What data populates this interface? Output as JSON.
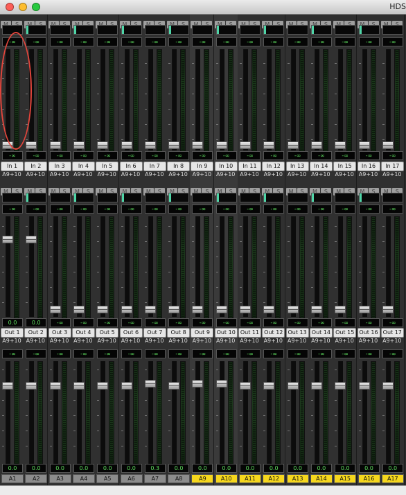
{
  "window": {
    "title": "HDS"
  },
  "strips": [
    {
      "in": "In 1",
      "out": "Out 1",
      "route": "A9+10",
      "a": "A1",
      "yellow": false,
      "gain": "0.0",
      "fader": "0.0",
      "h": 0.05
    },
    {
      "in": "In 2",
      "out": "Out 2",
      "route": "A9+10",
      "a": "A2",
      "yellow": false,
      "gain": "0.0",
      "fader": "0.0",
      "h": 0.05
    },
    {
      "in": "In 3",
      "out": "Out 3",
      "route": "A9+10",
      "a": "A3",
      "yellow": false,
      "gain": "-∞",
      "fader": "0.0",
      "h": 0.05
    },
    {
      "in": "In 4",
      "out": "Out 4",
      "route": "A9+10",
      "a": "A4",
      "yellow": false,
      "gain": "-∞",
      "fader": "0.0",
      "h": 0.05
    },
    {
      "in": "In 5",
      "out": "Out 5",
      "route": "A9+10",
      "a": "A5",
      "yellow": false,
      "gain": "-∞",
      "fader": "0.0",
      "h": 0.05
    },
    {
      "in": "In 6",
      "out": "Out 6",
      "route": "A9+10",
      "a": "A6",
      "yellow": false,
      "gain": "-∞",
      "fader": "0.0",
      "h": 0.05
    },
    {
      "in": "In 7",
      "out": "Out 7",
      "route": "A9+10",
      "a": "A7",
      "yellow": false,
      "gain": "-∞",
      "fader": "0.3",
      "h": 0.05
    },
    {
      "in": "In 8",
      "out": "Out 8",
      "route": "A9+10",
      "a": "A8",
      "yellow": false,
      "gain": "-∞",
      "fader": "0.0",
      "h": 0.05
    },
    {
      "in": "In 9",
      "out": "Out 9",
      "route": "A9+10",
      "a": "A9",
      "yellow": true,
      "gain": "-∞",
      "fader": "0.0",
      "h": 0.05
    },
    {
      "in": "In 10",
      "out": "Out 10",
      "route": "A9+10",
      "a": "A10",
      "yellow": true,
      "gain": "-∞",
      "fader": "0.0",
      "h": 0.05
    },
    {
      "in": "In 11",
      "out": "Out 11",
      "route": "A9+10",
      "a": "A11",
      "yellow": true,
      "gain": "-∞",
      "fader": "0.0",
      "h": 0.05
    },
    {
      "in": "In 12",
      "out": "Out 12",
      "route": "A9+10",
      "a": "A12",
      "yellow": true,
      "gain": "-∞",
      "fader": "0.0",
      "h": 0.05
    },
    {
      "in": "In 13",
      "out": "Out 13",
      "route": "A9+10",
      "a": "A13",
      "yellow": true,
      "gain": "-∞",
      "fader": "0.0",
      "h": 0.05
    },
    {
      "in": "In 14",
      "out": "Out 14",
      "route": "A9+10",
      "a": "A14",
      "yellow": true,
      "gain": "-∞",
      "fader": "0.0",
      "h": 0.05
    },
    {
      "in": "In 15",
      "out": "Out 15",
      "route": "A9+10",
      "a": "A15",
      "yellow": true,
      "gain": "-∞",
      "fader": "0.0",
      "h": 0.05
    },
    {
      "in": "In 16",
      "out": "Out 16",
      "route": "A9+10",
      "a": "A16",
      "yellow": true,
      "gain": "-∞",
      "fader": "0.0",
      "h": 0.05
    },
    {
      "in": "In 17",
      "out": "Out 17",
      "route": "A9+10",
      "a": "A17",
      "yellow": true,
      "gain": "-∞",
      "fader": "0.0",
      "h": 0.05
    }
  ],
  "labels": {
    "mute": "M",
    "solo": "S",
    "neg_inf": "-∞"
  }
}
